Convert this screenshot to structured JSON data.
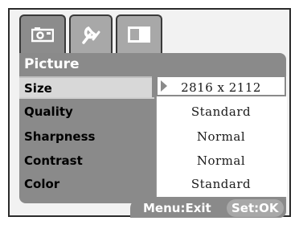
{
  "tabs": [
    {
      "icon": "camera-icon",
      "active": true
    },
    {
      "icon": "wrench-icon",
      "active": false
    },
    {
      "icon": "display-icon",
      "active": false
    }
  ],
  "panel": {
    "title": "Picture"
  },
  "menu": {
    "items": [
      {
        "label": "Size",
        "value": "2816 x 2112",
        "selected": true
      },
      {
        "label": "Quality",
        "value": "Standard",
        "selected": false
      },
      {
        "label": "Sharpness",
        "value": "Normal",
        "selected": false
      },
      {
        "label": "Contrast",
        "value": "Normal",
        "selected": false
      },
      {
        "label": "Color",
        "value": "Standard",
        "selected": false
      }
    ]
  },
  "footer": {
    "exit_hint": "Menu:Exit",
    "set_hint": "Set:OK"
  }
}
